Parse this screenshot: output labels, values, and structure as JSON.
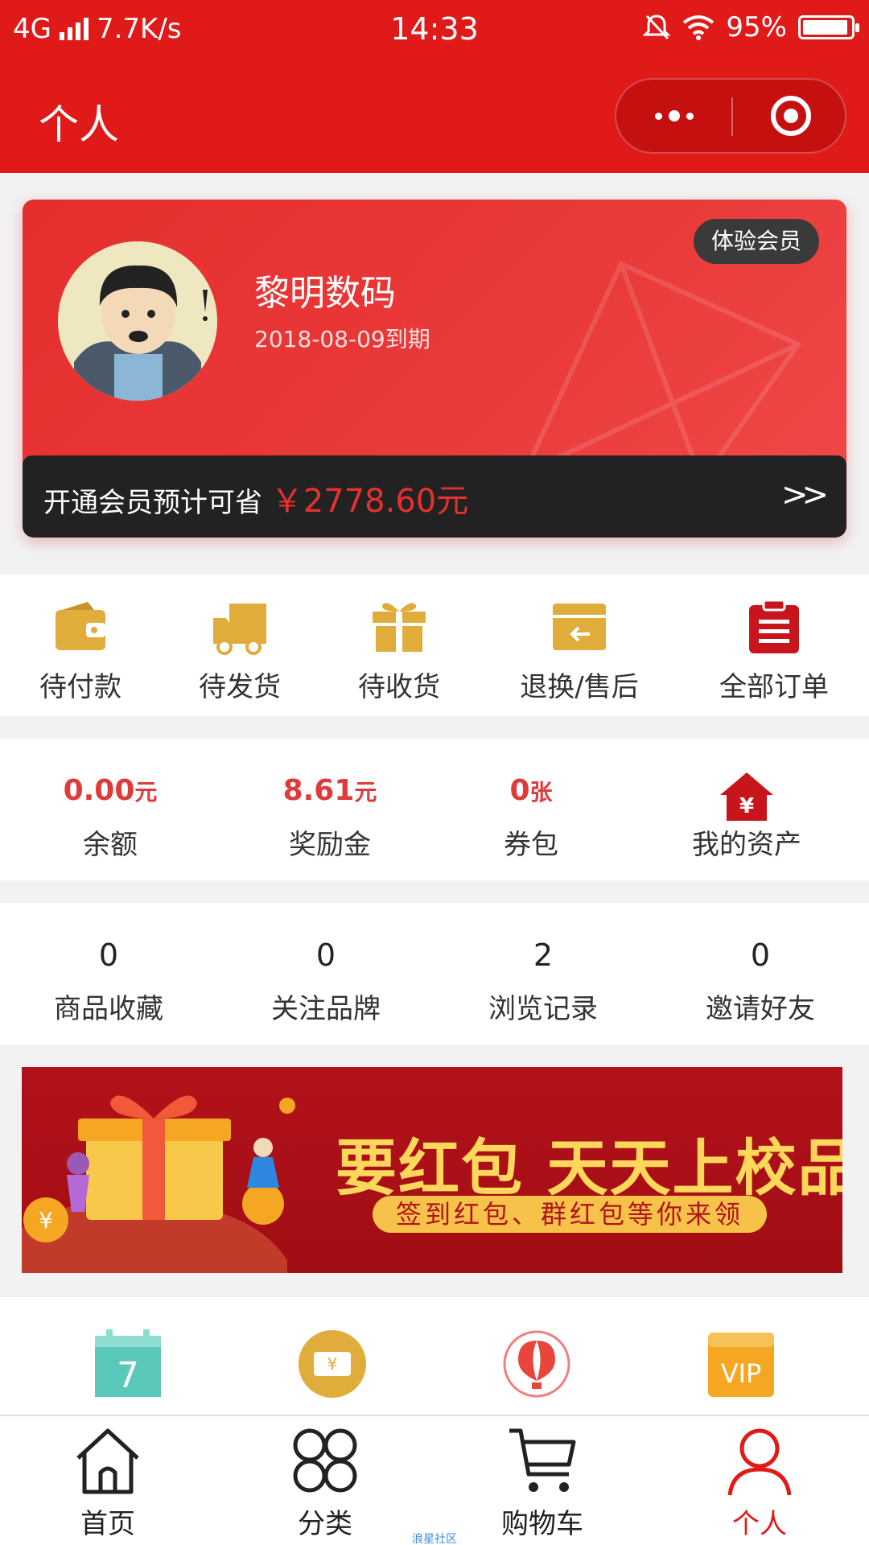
{
  "status_bar": {
    "network": "4G",
    "speed": "7.7K/s",
    "time": "14:33",
    "battery": "95%",
    "battery_level": 0.95
  },
  "nav": {
    "title": "个人"
  },
  "member": {
    "name": "黎明数码",
    "expire": "2018-08-09到期",
    "badge": "体验会员",
    "save_prefix": "开通会员预计可省",
    "save_amount": "￥2778.60元",
    "arrow": ">>"
  },
  "orders": [
    {
      "label": "待付款",
      "icon": "wallet-icon"
    },
    {
      "label": "待发货",
      "icon": "truck-icon"
    },
    {
      "label": "待收货",
      "icon": "gift-icon"
    },
    {
      "label": "退换/售后",
      "icon": "return-icon"
    },
    {
      "label": "全部订单",
      "icon": "clipboard-icon"
    }
  ],
  "assets": [
    {
      "value": "0.00",
      "unit": "元",
      "label": "余额"
    },
    {
      "value": "8.61",
      "unit": "元",
      "label": "奖励金"
    },
    {
      "value": "0",
      "unit": "张",
      "label": "券包"
    },
    {
      "label": "我的资产",
      "icon": "house-yen-icon"
    }
  ],
  "stats": [
    {
      "value": "0",
      "label": "商品收藏"
    },
    {
      "value": "0",
      "label": "关注品牌"
    },
    {
      "value": "2",
      "label": "浏览记录"
    },
    {
      "value": "0",
      "label": "邀请好友"
    }
  ],
  "banner": {
    "headline": "要红包 天天上校品会",
    "subtitle": "签到红包、群红包等你来领"
  },
  "quick_icons": [
    "calendar-icon",
    "coupon-icon",
    "balloon-icon",
    "vip-icon"
  ],
  "calendar_day": "7",
  "tabs": [
    {
      "label": "首页",
      "icon": "home-icon"
    },
    {
      "label": "分类",
      "icon": "category-icon"
    },
    {
      "label": "购物车",
      "icon": "cart-icon"
    },
    {
      "label": "个人",
      "icon": "person-icon",
      "active": true
    }
  ],
  "watermark": "浪星社区",
  "colors": {
    "brand_red": "#e01919",
    "gold": "#e0ad3c",
    "teal": "#5ac8b8",
    "orange": "#f5a623"
  }
}
